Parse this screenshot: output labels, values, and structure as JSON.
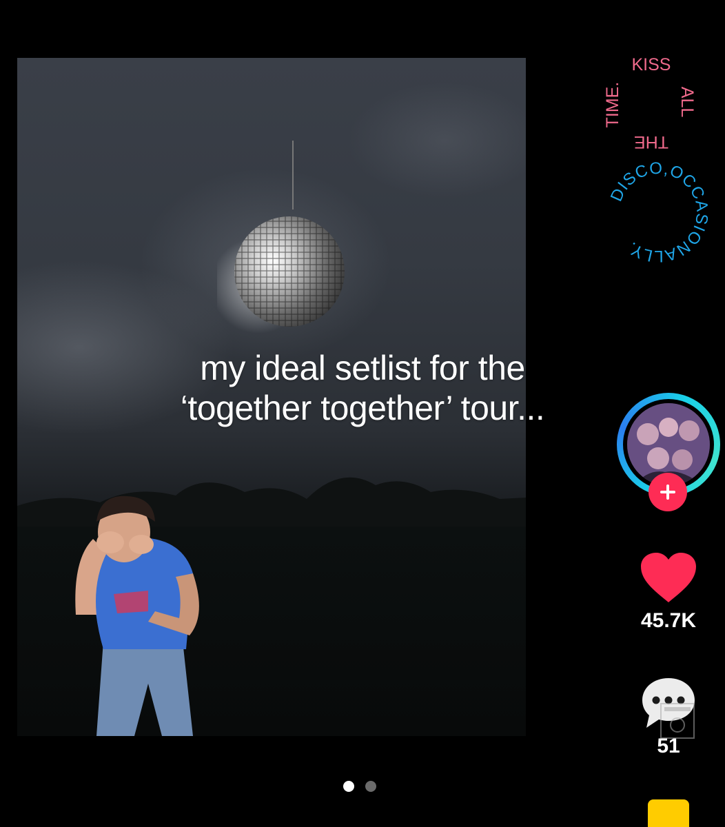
{
  "video": {
    "caption_line1": "my ideal setlist for the",
    "caption_line2": "‘together together’ tour..."
  },
  "logo": {
    "top_words": [
      "KISS",
      "ALL",
      "THE",
      "TIME."
    ],
    "bottom_text": "DISCO,OCCASIONALLY.",
    "top_color": "#f06a8c",
    "bottom_color": "#1fa6e8"
  },
  "actions": {
    "follow_icon": "plus-icon",
    "like_icon": "heart-icon",
    "like_count": "45.7K",
    "comment_icon": "comment-bubble-icon",
    "comment_count": "51"
  },
  "pager": {
    "total": 2,
    "active": 1
  },
  "colors": {
    "like": "#fe2c55",
    "follow": "#fe2c55",
    "ring": "#1ad1e8",
    "nav_accent": "#ffcc00"
  }
}
